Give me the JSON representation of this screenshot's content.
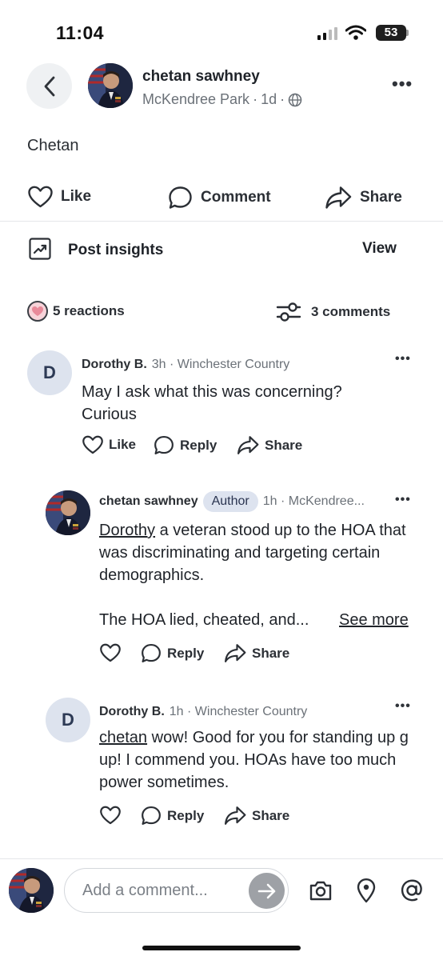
{
  "status_bar": {
    "time": "11:04",
    "battery": "53"
  },
  "post": {
    "author_name": "chetan sawhney",
    "location": "McKendree Park",
    "age": "1d",
    "separator": "·",
    "body": "Chetan",
    "actions": {
      "like": "Like",
      "comment": "Comment",
      "share": "Share"
    }
  },
  "insights": {
    "label": "Post insights",
    "view": "View"
  },
  "summary": {
    "reactions": "5 reactions",
    "comments": "3 comments"
  },
  "comments": [
    {
      "initial": "D",
      "name": "Dorothy B.",
      "meta": "3h · Winchester Country",
      "text": "May I ask what this was concerning? Curious",
      "actions": {
        "like": "Like",
        "reply": "Reply",
        "share": "Share"
      }
    },
    {
      "name": "chetan sawhney",
      "badge": "Author",
      "meta": "1h · McKendree...",
      "mention": "Dorothy",
      "text": " a veteran stood up to the HOA that was discriminating and targeting certain demographics.",
      "text2": "The HOA lied, cheated, and...",
      "see_more": "See more",
      "actions": {
        "reply": "Reply",
        "share": "Share"
      }
    },
    {
      "initial": "D",
      "name": "Dorothy B.",
      "meta": "1h · Winchester Country",
      "mention": "chetan",
      "text": " wow!  Good for you for standing up g up!  I commend you. HOAs have too much power sometimes.",
      "actions": {
        "reply": "Reply",
        "share": "Share"
      }
    }
  ],
  "composer": {
    "placeholder": "Add a comment..."
  },
  "colors": {
    "accent_bg": "#dde3ef",
    "reaction_pink": "#f7d3d9",
    "send_button": "#9ea1a6"
  }
}
